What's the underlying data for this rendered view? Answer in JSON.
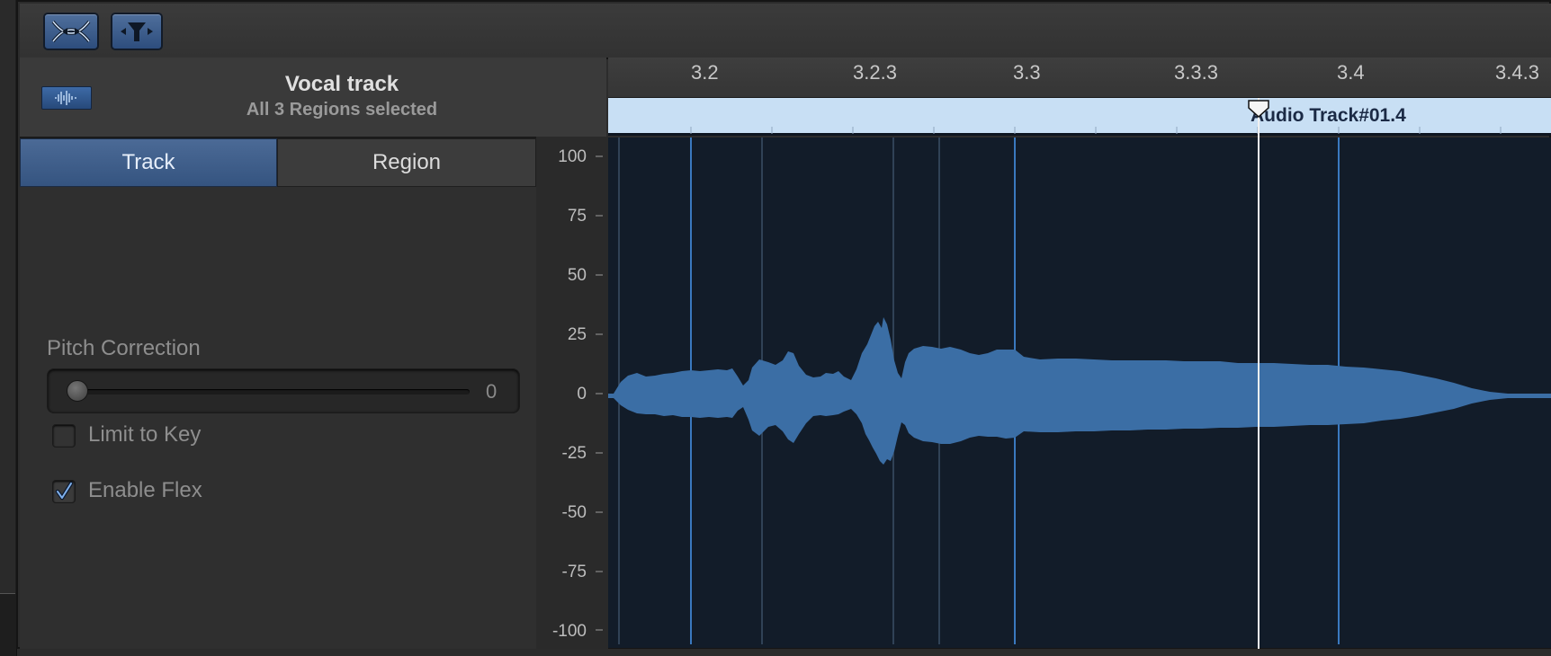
{
  "track": {
    "name": "Vocal track",
    "selection_info": "All 3 Regions selected"
  },
  "tabs": [
    {
      "label": "Track",
      "selected": true
    },
    {
      "label": "Region",
      "selected": false
    }
  ],
  "pitch_correction": {
    "label": "Pitch Correction",
    "value": "0",
    "level": 0
  },
  "limit_to_key": {
    "label": "Limit to Key",
    "checked": false
  },
  "enable_flex": {
    "label": "Enable Flex",
    "checked": true
  },
  "ruler": {
    "ticks": [
      "3.2",
      "3.2.3",
      "3.3",
      "3.3.3",
      "3.4",
      "3.4.3"
    ]
  },
  "region": {
    "name": "Audio Track#01.4"
  },
  "amplitude_axis": {
    "labels": [
      "100",
      "75",
      "50",
      "25",
      "0",
      "-25",
      "-50",
      "-75",
      "-100"
    ]
  },
  "toolbar": {
    "buttons": [
      "flex-icon",
      "transient-icon"
    ]
  },
  "colors": {
    "accent": "#3c6aa8",
    "waveform": "#3b6ea5",
    "region_bar": "#c8dff4",
    "waveform_bg": "#121c29"
  }
}
